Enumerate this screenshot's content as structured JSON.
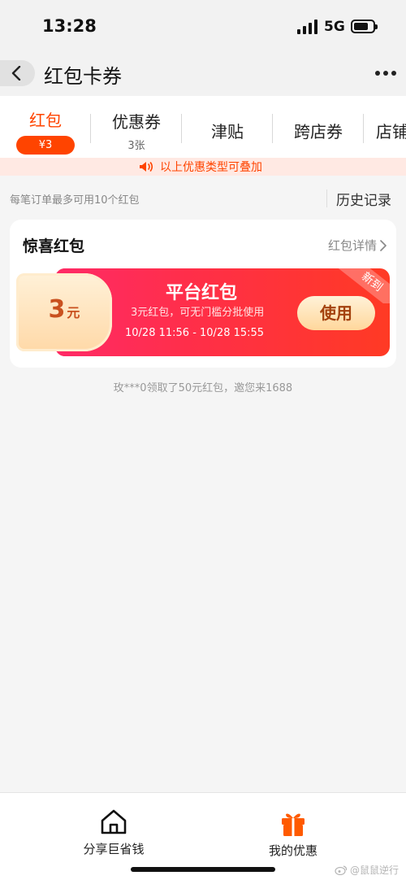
{
  "status_bar": {
    "time": "13:28",
    "network": "5G"
  },
  "nav": {
    "title": "红包卡券"
  },
  "tabs": [
    {
      "label": "红包",
      "badge": "¥3"
    },
    {
      "label": "优惠券",
      "sub": "3张"
    },
    {
      "label": "津贴"
    },
    {
      "label": "跨店券"
    },
    {
      "label": "店铺"
    }
  ],
  "notice": {
    "text": "以上优惠类型可叠加"
  },
  "info": {
    "limit_text": "每笔订单最多可用10个红包",
    "history_label": "历史记录"
  },
  "section": {
    "title": "惊喜红包",
    "detail_link": "红包详情"
  },
  "coupon": {
    "amount": "3",
    "unit": "元",
    "name": "平台红包",
    "desc": "3元红包，可无门槛分批使用",
    "time": "10/28 11:56 - 10/28 15:55",
    "button": "使用",
    "tag": "新到"
  },
  "footer_note": "玫***0领取了50元红包，邀您来1688",
  "bottom_nav": [
    {
      "label": "分享巨省钱",
      "icon": "home-icon"
    },
    {
      "label": "我的优惠",
      "icon": "gift-icon"
    }
  ],
  "watermark": "@鼠鼠逆行",
  "colors": {
    "accent": "#ff4400",
    "coupon_red": "#ff2f46",
    "coupon_gold": "#ffd79c"
  }
}
